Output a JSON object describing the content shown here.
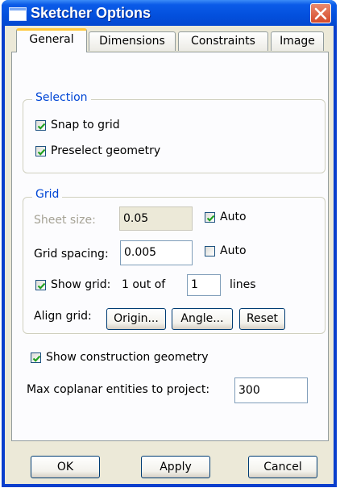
{
  "window": {
    "title": "Sketcher Options"
  },
  "tabs": [
    {
      "label": "General",
      "active": true
    },
    {
      "label": "Dimensions",
      "active": false
    },
    {
      "label": "Constraints",
      "active": false
    },
    {
      "label": "Image",
      "active": false
    }
  ],
  "selection": {
    "legend": "Selection",
    "snap_to_grid": {
      "label": "Snap to grid",
      "checked": true
    },
    "preselect_geometry": {
      "label": "Preselect geometry",
      "checked": true
    }
  },
  "grid": {
    "legend": "Grid",
    "sheet_size": {
      "label": "Sheet size:",
      "value": "0.05",
      "auto_label": "Auto",
      "auto_checked": true
    },
    "grid_spacing": {
      "label": "Grid spacing:",
      "value": "0.005",
      "auto_label": "Auto",
      "auto_checked": false
    },
    "show_grid": {
      "label": "Show grid:",
      "checked": true,
      "prefix": "1 out of",
      "value": "1",
      "suffix": "lines"
    },
    "align_grid": {
      "label": "Align grid:",
      "origin_button": "Origin...",
      "angle_button": "Angle...",
      "reset_button": "Reset"
    }
  },
  "construction": {
    "label": "Show construction geometry",
    "checked": true
  },
  "max_coplanar": {
    "label": "Max coplanar entities to project:",
    "value": "300"
  },
  "buttons": {
    "ok": "OK",
    "apply": "Apply",
    "cancel": "Cancel"
  },
  "colors": {
    "titlebar": "#0350dd",
    "accent": "#0046d5",
    "tab_highlight": "#ffc83c",
    "check": "#21a121"
  }
}
